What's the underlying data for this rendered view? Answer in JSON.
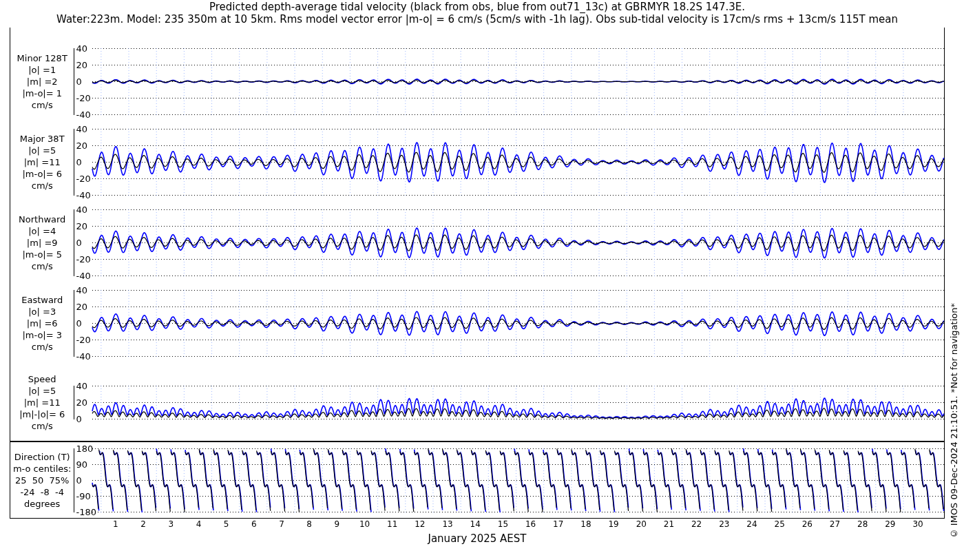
{
  "title_lines": [
    "Predicted depth-average tidal velocity (black from obs, blue from out71_13c) at GBRMYR 18.2S 147.3E.",
    "Water:223m. Model: 235 350m at 10 5km. Rms model vector error |m-o| = 6 cm/s (5cm/s with -1h lag). Obs sub-tidal velocity is 17cm/s rms + 13cm/s 115T mean"
  ],
  "panels": [
    {
      "kind": "velocity",
      "label_lines": [
        "Minor 128T",
        "|o| =1",
        "|m| =2",
        "|m-o|= 1",
        "cm/s"
      ],
      "yticks": [
        "40",
        "20",
        "0",
        "-20",
        "-40"
      ]
    },
    {
      "kind": "velocity",
      "label_lines": [
        "Major 38T",
        "|o| =5",
        "|m| =11",
        "|m-o|= 6",
        "cm/s"
      ],
      "yticks": [
        "40",
        "20",
        "0",
        "-20",
        "-40"
      ]
    },
    {
      "kind": "velocity",
      "label_lines": [
        "Northward",
        "|o| =4",
        "|m| =9",
        "|m-o|= 5",
        "cm/s"
      ],
      "yticks": [
        "40",
        "20",
        "0",
        "-20",
        "-40"
      ]
    },
    {
      "kind": "velocity",
      "label_lines": [
        "Eastward",
        "|o| =3",
        "|m| =6",
        "|m-o|= 3",
        "cm/s"
      ],
      "yticks": [
        "40",
        "20",
        "0",
        "-20",
        "-40"
      ]
    },
    {
      "kind": "speed",
      "label_lines": [
        "Speed",
        "|o| =5",
        "|m| =11",
        "|m|-|o|= 6",
        "cm/s"
      ],
      "yticks": [
        "40",
        "20",
        "0"
      ]
    }
  ],
  "direction_panel": {
    "kind": "direction",
    "label_lines": [
      "Direction (T)",
      "m-o centiles:",
      "25  50  75%",
      "-24  -8  -4",
      "degrees"
    ],
    "yticks": [
      "180",
      "90",
      "0",
      "-90",
      "-180"
    ]
  },
  "x_axis": {
    "days": [
      "1",
      "2",
      "3",
      "4",
      "5",
      "6",
      "7",
      "8",
      "9",
      "10",
      "11",
      "12",
      "13",
      "14",
      "15",
      "16",
      "17",
      "18",
      "19",
      "20",
      "21",
      "22",
      "23",
      "24",
      "25",
      "26",
      "27",
      "28",
      "29",
      "30"
    ],
    "label": "January 2025 AEST"
  },
  "credit": "© IMOS 09-Dec-2024 21:10:51. *Not for navigation*"
}
